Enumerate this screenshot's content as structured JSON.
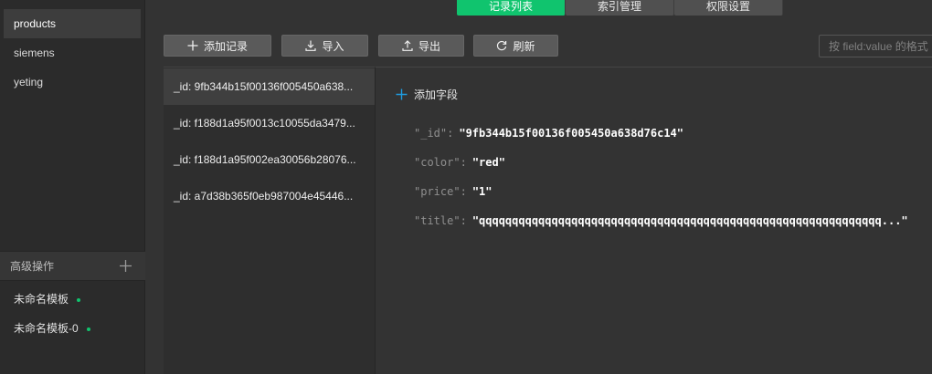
{
  "sidebar": {
    "collections": [
      {
        "label": "products"
      },
      {
        "label": "siemens"
      },
      {
        "label": "yeting"
      }
    ],
    "advanced": {
      "title": "高级操作",
      "templates": [
        {
          "label": "未命名模板"
        },
        {
          "label": "未命名模板-0"
        }
      ]
    },
    "status_color": "#10c46e"
  },
  "tabs": [
    {
      "label": "记录列表",
      "active": true
    },
    {
      "label": "索引管理",
      "active": false
    },
    {
      "label": "权限设置",
      "active": false
    }
  ],
  "toolbar": {
    "add_label": "添加记录",
    "import_label": "导入",
    "export_label": "导出",
    "refresh_label": "刷新",
    "search_placeholder": "按 field:value 的格式"
  },
  "records": [
    {
      "label": "_id: 9fb344b15f00136f005450a638..."
    },
    {
      "label": "_id: f188d1a95f0013c10055da3479..."
    },
    {
      "label": "_id: f188d1a95f002ea30056b28076..."
    },
    {
      "label": "_id: a7d38b365f0eb987004e45446..."
    }
  ],
  "detail": {
    "add_field_label": "添加字段",
    "fields": [
      {
        "key": "\"_id\"",
        "value": "\"9fb344b15f00136f005450a638d76c14\""
      },
      {
        "key": "\"color\"",
        "value": "\"red\""
      },
      {
        "key": "\"price\"",
        "value": "\"1\""
      },
      {
        "key": "\"title\"",
        "value": "\"qqqqqqqqqqqqqqqqqqqqqqqqqqqqqqqqqqqqqqqqqqqqqqqqqqqqqqqqqqqqq...\""
      }
    ]
  },
  "accent_color": "#10c46e",
  "icon_color": "#1f9ce0"
}
